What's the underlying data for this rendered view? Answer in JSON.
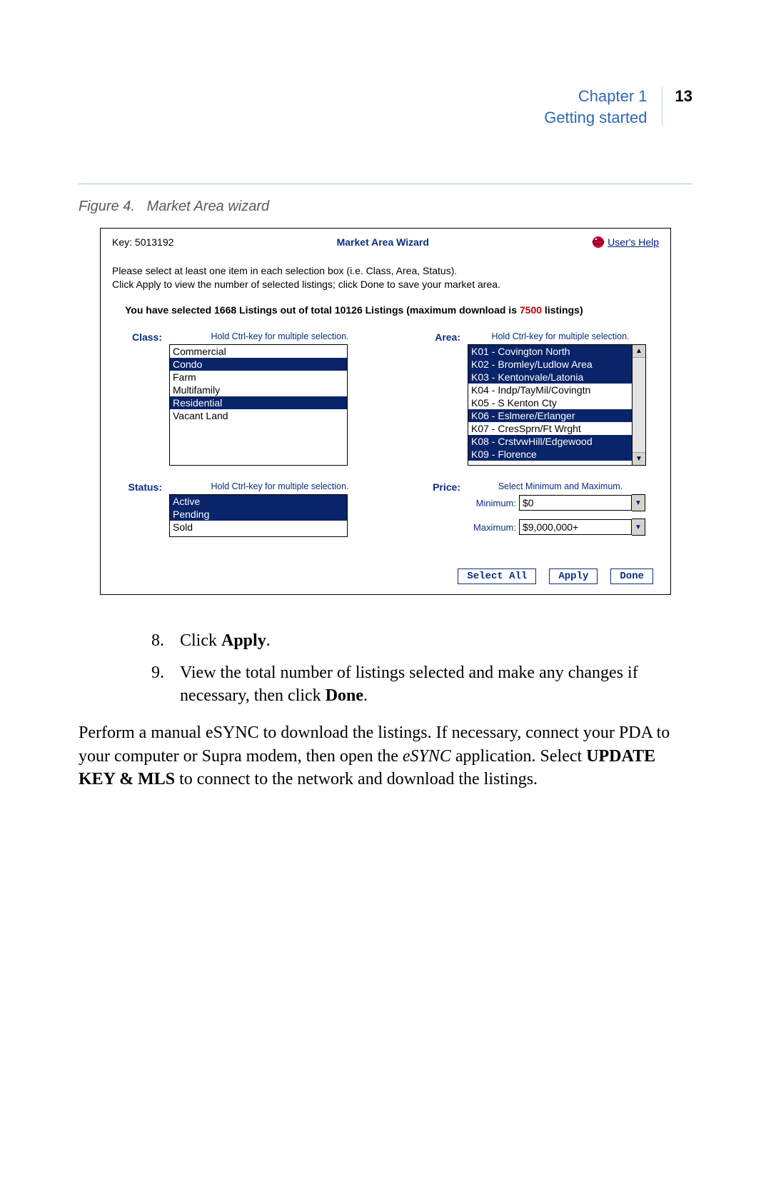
{
  "header": {
    "chapter": "Chapter 1",
    "subtitle": "Getting started",
    "page_num": "13"
  },
  "figure_caption": {
    "label": "Figure 4.",
    "title": "Market Area wizard"
  },
  "wizard": {
    "key_label": "Key: 5013192",
    "title": "Market Area Wizard",
    "help_link": "User's Help",
    "instr_line1": "Please select at least one item in each selection box (i.e. Class, Area, Status).",
    "instr_line2": "Click Apply to view the number of selected listings; click Done to save your market area.",
    "selection_prefix": "You have selected 1668 Listings out of total 10126 Listings (maximum download is ",
    "selection_highlight": "7500",
    "selection_suffix": " listings)",
    "hint_ctrl": "Hold Ctrl-key for multiple selection.",
    "hint_price": "Select Minimum and Maximum.",
    "labels": {
      "class": "Class:",
      "area": "Area:",
      "status": "Status:",
      "price": "Price:",
      "minimum": "Minimum:",
      "maximum": "Maximum:"
    },
    "class_options": [
      {
        "label": "Commercial",
        "selected": false
      },
      {
        "label": "Condo",
        "selected": true
      },
      {
        "label": "Farm",
        "selected": false
      },
      {
        "label": "Multifamily",
        "selected": false
      },
      {
        "label": "Residential",
        "selected": true
      },
      {
        "label": "Vacant Land",
        "selected": false
      }
    ],
    "area_options": [
      {
        "label": "K01 - Covington North",
        "selected": true
      },
      {
        "label": "K02 - Bromley/Ludlow Area",
        "selected": true
      },
      {
        "label": "K03 - Kentonvale/Latonia",
        "selected": true
      },
      {
        "label": "K04 - Indp/TayMil/Covingtn",
        "selected": false
      },
      {
        "label": "K05 - S Kenton Cty",
        "selected": false
      },
      {
        "label": "K06 - Eslmere/Erlanger",
        "selected": true
      },
      {
        "label": "K07 - CresSprn/Ft Wrght",
        "selected": false
      },
      {
        "label": "K08 - CrstvwHill/Edgewood",
        "selected": true
      },
      {
        "label": "K09 - Florence",
        "selected": true
      }
    ],
    "status_options": [
      {
        "label": "Active",
        "selected": true
      },
      {
        "label": "Pending",
        "selected": true
      },
      {
        "label": "Sold",
        "selected": false
      }
    ],
    "price": {
      "minimum": "$0",
      "maximum": "$9,000,000+"
    },
    "buttons": {
      "select_all": "Select All",
      "apply": "Apply",
      "done": "Done"
    }
  },
  "body": {
    "step8_num": "8.",
    "step8_text_a": "Click ",
    "step8_text_b": "Apply",
    "step8_text_c": ".",
    "step9_num": "9.",
    "step9_text_a": "View the total number of listings selected and make any changes if necessary, then click ",
    "step9_text_b": "Done",
    "step9_text_c": ".",
    "para_a": "Perform a manual eSYNC to download the listings.  If necessary, connect your PDA to your computer or Supra modem, then open the ",
    "para_b": "eSYNC",
    "para_c": " application.  Select ",
    "para_d": "UPDATE KEY & MLS",
    "para_e": " to connect to the network and download the listings."
  }
}
